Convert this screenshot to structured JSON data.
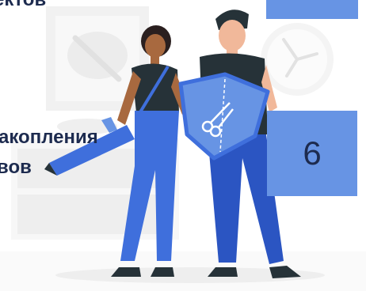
{
  "headings": {
    "line1": "ектов",
    "line2": "акопления",
    "line3": "вов"
  },
  "tile": {
    "number": "6"
  },
  "colors": {
    "heading_text": "#1d2b4f",
    "tile_fill": "#6794e4",
    "accent_blue": "#3f6fdc"
  }
}
